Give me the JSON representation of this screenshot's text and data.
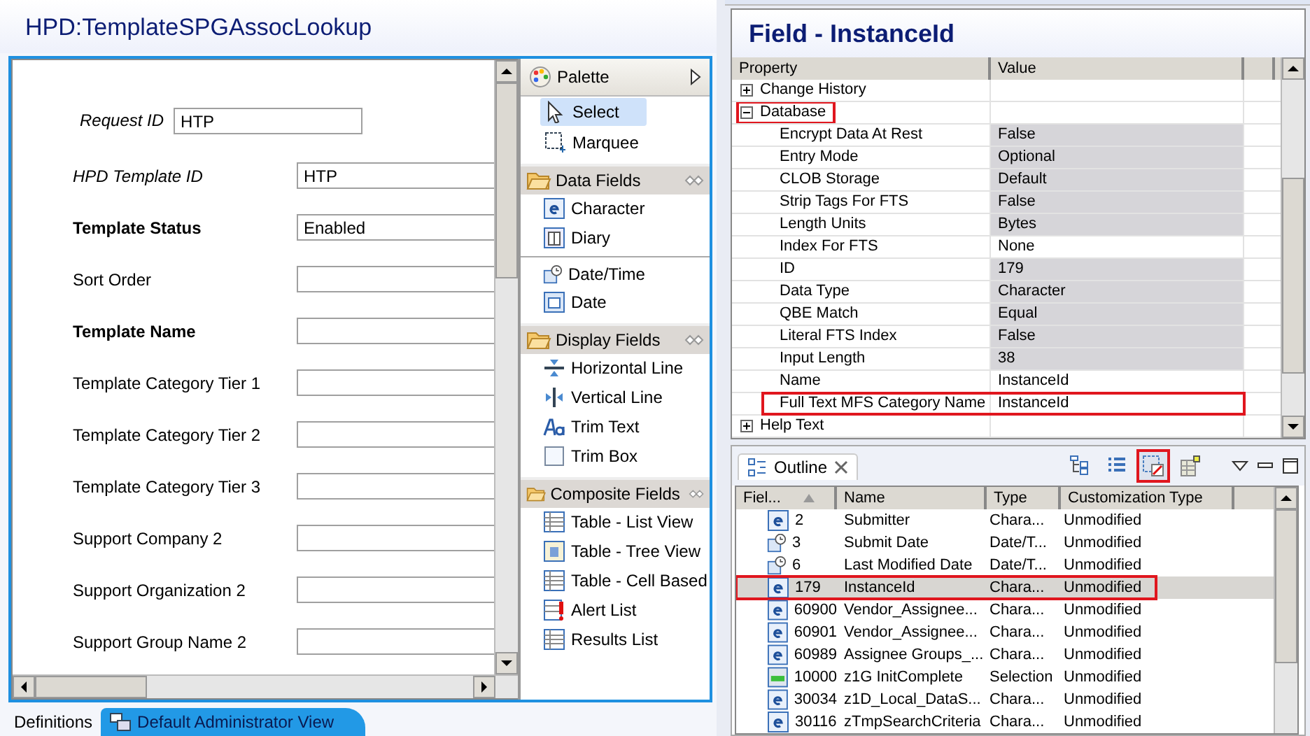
{
  "editor": {
    "title": "HPD:TemplateSPGAssocLookup",
    "form_fields": [
      {
        "label": "Request ID",
        "kind": "italic",
        "value": "HTP"
      },
      {
        "label": "HPD Template ID",
        "kind": "italic",
        "value": "HTP"
      },
      {
        "label": "Template Status",
        "kind": "bold",
        "value": "Enabled"
      },
      {
        "label": "Sort Order",
        "kind": "plain"
      },
      {
        "label": "Template Name",
        "kind": "bold"
      },
      {
        "label": "Template Category Tier 1",
        "kind": "plain"
      },
      {
        "label": "Template Category Tier 2",
        "kind": "plain"
      },
      {
        "label": "Template Category Tier 3",
        "kind": "plain"
      },
      {
        "label": "Support Company 2",
        "kind": "plain"
      },
      {
        "label": "Support Organization 2",
        "kind": "plain"
      },
      {
        "label": "Support Group Name 2",
        "kind": "plain"
      }
    ],
    "palette": {
      "title": "Palette",
      "tools": [
        {
          "label": "Select",
          "kind": "pointer",
          "selected": true
        },
        {
          "label": "Marquee",
          "kind": "marquee",
          "selected": false
        }
      ],
      "sections": [
        {
          "title": "Data Fields",
          "items": [
            {
              "label": "Character",
              "kind": "character"
            },
            {
              "label": "Diary",
              "kind": "book"
            },
            {
              "label": "Date/Time",
              "kind": "datetime",
              "divider": true
            },
            {
              "label": "Date",
              "kind": "calendar"
            }
          ]
        },
        {
          "title": "Display Fields",
          "items": [
            {
              "label": "Horizontal Line",
              "kind": "hline"
            },
            {
              "label": "Vertical Line",
              "kind": "vline"
            },
            {
              "label": "Trim Text",
              "kind": "text"
            },
            {
              "label": "Trim Box",
              "kind": "box"
            }
          ]
        },
        {
          "title": "Composite Fields",
          "items": [
            {
              "label": "Table - List View",
              "kind": "table"
            },
            {
              "label": "Table - Tree View",
              "kind": "tree"
            },
            {
              "label": "Table - Cell Based",
              "kind": "table"
            },
            {
              "label": "Alert List",
              "kind": "alert"
            },
            {
              "label": "Results List",
              "kind": "table"
            }
          ]
        }
      ]
    },
    "tabs": [
      {
        "label": "Definitions",
        "selected": false
      },
      {
        "label": "Default Administrator View",
        "selected": true
      }
    ]
  },
  "properties": {
    "title": "Field - InstanceId",
    "columns": [
      "Property",
      "Value"
    ],
    "rows": [
      {
        "label": "Change History",
        "expanded": false,
        "highlighted": false
      },
      {
        "label": "Database",
        "expanded": true,
        "highlighted": true,
        "children": [
          {
            "property": "Encrypt Data At Rest",
            "value": "False",
            "greyed": true,
            "highlighted": false
          },
          {
            "property": "Entry Mode",
            "value": "Optional",
            "greyed": true,
            "highlighted": false
          },
          {
            "property": "CLOB Storage",
            "value": "Default",
            "greyed": true,
            "highlighted": false
          },
          {
            "property": "Strip Tags For FTS",
            "value": "False",
            "greyed": true,
            "highlighted": false
          },
          {
            "property": "Length Units",
            "value": "Bytes",
            "greyed": true,
            "highlighted": false
          },
          {
            "property": "Index For FTS",
            "value": "None",
            "greyed": false,
            "highlighted": false
          },
          {
            "property": "ID",
            "value": "179",
            "greyed": true,
            "highlighted": false
          },
          {
            "property": "Data Type",
            "value": "Character",
            "greyed": true,
            "highlighted": false
          },
          {
            "property": "QBE Match",
            "value": "Equal",
            "greyed": true,
            "highlighted": false
          },
          {
            "property": "Literal FTS Index",
            "value": "False",
            "greyed": true,
            "highlighted": false
          },
          {
            "property": "Input Length",
            "value": "38",
            "greyed": true,
            "highlighted": false
          },
          {
            "property": "Name",
            "value": "InstanceId",
            "greyed": false,
            "highlighted": false
          },
          {
            "property": "Full Text MFS Category Name",
            "value": "InstanceId",
            "greyed": false,
            "highlighted": true
          }
        ]
      },
      {
        "label": "Help Text",
        "expanded": false,
        "highlighted": false
      }
    ]
  },
  "outline": {
    "tab": "Outline",
    "toolbar": [
      {
        "kind": "tree",
        "highlighted": false
      },
      {
        "kind": "list",
        "highlighted": false
      },
      {
        "kind": "filter",
        "highlighted": true
      },
      {
        "kind": "grid",
        "highlighted": false
      }
    ],
    "columns": [
      "Fiel...",
      "Name",
      "Type",
      "Customization Type"
    ],
    "rows": [
      {
        "kind": "character",
        "id": "2",
        "name": "Submitter",
        "type": "Chara...",
        "customization": "Unmodified",
        "selected": false,
        "highlighted": false
      },
      {
        "kind": "datetime",
        "id": "3",
        "name": "Submit Date",
        "type": "Date/T...",
        "customization": "Unmodified",
        "selected": false,
        "highlighted": false
      },
      {
        "kind": "datetime",
        "id": "6",
        "name": "Last Modified Date",
        "type": "Date/T...",
        "customization": "Unmodified",
        "selected": false,
        "highlighted": false
      },
      {
        "kind": "character",
        "id": "179",
        "name": "InstanceId",
        "type": "Chara...",
        "customization": "Unmodified",
        "selected": true,
        "highlighted": true
      },
      {
        "kind": "character",
        "id": "60900",
        "name": "Vendor_Assignee...",
        "type": "Chara...",
        "customization": "Unmodified",
        "selected": false,
        "highlighted": false
      },
      {
        "kind": "character",
        "id": "60901",
        "name": "Vendor_Assignee...",
        "type": "Chara...",
        "customization": "Unmodified",
        "selected": false,
        "highlighted": false
      },
      {
        "kind": "character",
        "id": "60989",
        "name": "Assignee Groups_...",
        "type": "Chara...",
        "customization": "Unmodified",
        "selected": false,
        "highlighted": false
      },
      {
        "kind": "selection",
        "id": "10000",
        "name": "z1G InitComplete",
        "type": "Selection",
        "customization": "Unmodified",
        "selected": false,
        "highlighted": false
      },
      {
        "kind": "character",
        "id": "30034",
        "name": "z1D_Local_DataS...",
        "type": "Chara...",
        "customization": "Unmodified",
        "selected": false,
        "highlighted": false
      },
      {
        "kind": "character",
        "id": "30116",
        "name": "zTmpSearchCriteria",
        "type": "Chara...",
        "customization": "Unmodified",
        "selected": false,
        "highlighted": false
      }
    ]
  }
}
